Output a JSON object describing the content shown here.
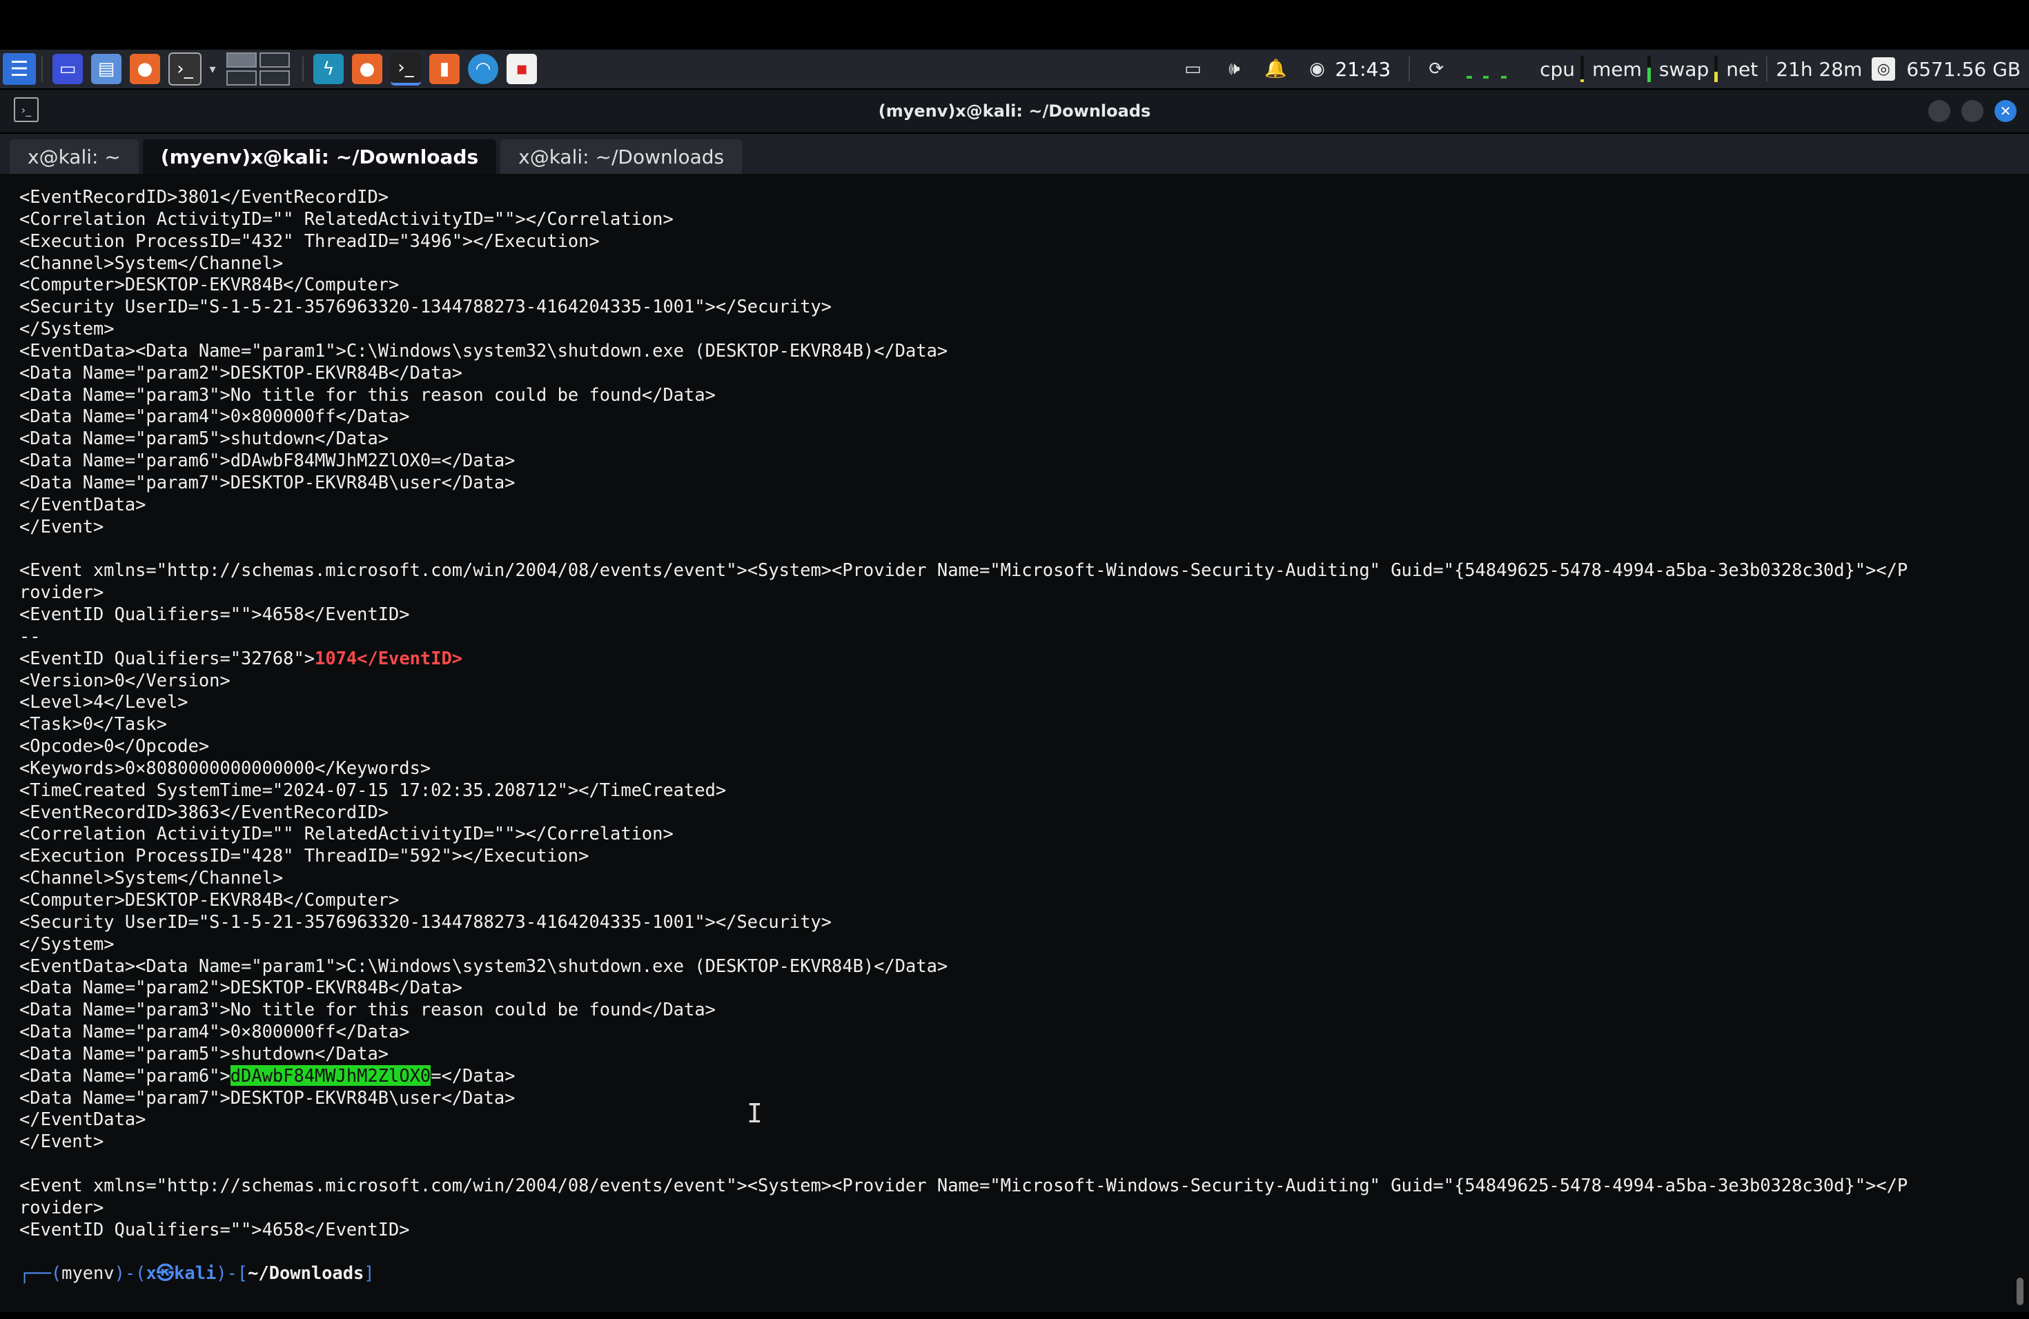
{
  "panel": {
    "clock": "21:43",
    "plugins": {
      "cpu_label": "cpu",
      "mem_label": "mem",
      "swap_label": "swap",
      "net_label": "net",
      "uptime": "21h 28m",
      "disk_free": "6571.56 GB"
    },
    "colors": {
      "cpu": "#e7d93a",
      "mem": "#3bd14d",
      "swap": "#e7d93a"
    }
  },
  "window": {
    "title": "(myenv)x@kali: ~/Downloads",
    "tabs": [
      {
        "label": "x@kali: ~"
      },
      {
        "label": "(myenv)x@kali: ~/Downloads"
      },
      {
        "label": "x@kali: ~/Downloads"
      }
    ]
  },
  "terminal": {
    "lines": [
      "<EventRecordID>3801</EventRecordID>",
      "<Correlation ActivityID=\"\" RelatedActivityID=\"\"></Correlation>",
      "<Execution ProcessID=\"432\" ThreadID=\"3496\"></Execution>",
      "<Channel>System</Channel>",
      "<Computer>DESKTOP-EKVR84B</Computer>",
      "<Security UserID=\"S-1-5-21-3576963320-1344788273-4164204335-1001\"></Security>",
      "</System>",
      "<EventData><Data Name=\"param1\">C:\\Windows\\system32\\shutdown.exe (DESKTOP-EKVR84B)</Data>",
      "<Data Name=\"param2\">DESKTOP-EKVR84B</Data>",
      "<Data Name=\"param3\">No title for this reason could be found</Data>",
      "<Data Name=\"param4\">0×800000ff</Data>",
      "<Data Name=\"param5\">shutdown</Data>",
      "<Data Name=\"param6\">dDAwbF84MWJhM2ZlOX0=</Data>",
      "<Data Name=\"param7\">DESKTOP-EKVR84B\\user</Data>",
      "</EventData>",
      "</Event>",
      "",
      "<Event xmlns=\"http://schemas.microsoft.com/win/2004/08/events/event\"><System><Provider Name=\"Microsoft-Windows-Security-Auditing\" Guid=\"{54849625-5478-4994-a5ba-3e3b0328c30d}\"></P",
      "rovider>",
      "<EventID Qualifiers=\"\">4658</EventID>",
      "--",
      "<EventID Qualifiers=\"32768\">",
      "<Version>0</Version>",
      "<Level>4</Level>",
      "<Task>0</Task>",
      "<Opcode>0</Opcode>",
      "<Keywords>0×8080000000000000</Keywords>",
      "<TimeCreated SystemTime=\"2024-07-15 17:02:35.208712\"></TimeCreated>",
      "<EventRecordID>3863</EventRecordID>",
      "<Correlation ActivityID=\"\" RelatedActivityID=\"\"></Correlation>",
      "<Execution ProcessID=\"428\" ThreadID=\"592\"></Execution>",
      "<Channel>System</Channel>",
      "<Computer>DESKTOP-EKVR84B</Computer>",
      "<Security UserID=\"S-1-5-21-3576963320-1344788273-4164204335-1001\"></Security>",
      "</System>",
      "<EventData><Data Name=\"param1\">C:\\Windows\\system32\\shutdown.exe (DESKTOP-EKVR84B)</Data>",
      "<Data Name=\"param2\">DESKTOP-EKVR84B</Data>",
      "<Data Name=\"param3\">No title for this reason could be found</Data>",
      "<Data Name=\"param4\">0×800000ff</Data>",
      "<Data Name=\"param5\">shutdown</Data>",
      "<Data Name=\"param6\">",
      "<Data Name=\"param7\">DESKTOP-EKVR84B\\user</Data>",
      "</EventData>",
      "</Event>",
      "",
      "<Event xmlns=\"http://schemas.microsoft.com/win/2004/08/events/event\"><System><Provider Name=\"Microsoft-Windows-Security-Auditing\" Guid=\"{54849625-5478-4994-a5ba-3e3b0328c30d}\"></P",
      "rovider>",
      "<EventID Qualifiers=\"\">4658</EventID>",
      ""
    ],
    "match_eventid": "1074</EventID>",
    "match_param6": "dDAwbF84MWJhM2ZlOX0",
    "match_param6_rest": "=</Data>",
    "prompt": {
      "prefix": "┌──(",
      "env": "myenv",
      "mid": ")-(",
      "user": "x㉿kali",
      "mid2": ")-[",
      "dir": "~/Downloads",
      "suffix": "]"
    }
  }
}
